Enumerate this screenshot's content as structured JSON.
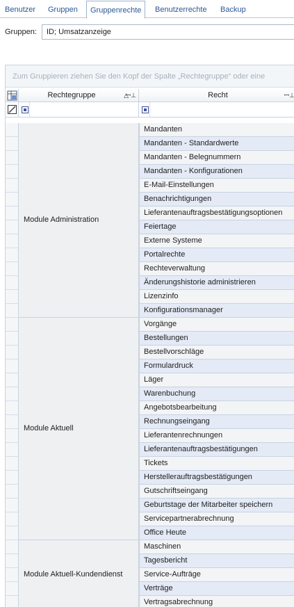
{
  "tabs": [
    {
      "label": "Benutzer",
      "active": false
    },
    {
      "label": "Gruppen",
      "active": false
    },
    {
      "label": "Gruppenrechte",
      "active": true
    },
    {
      "label": "Benutzerrechte",
      "active": false
    },
    {
      "label": "Backup",
      "active": false
    }
  ],
  "group_selector": {
    "label": "Gruppen:",
    "value": "ID; Umsatzanzeige"
  },
  "grid": {
    "group_hint": "Zum Gruppieren ziehen Sie den Kopf der Spalte „Rechtegruppe“ oder eine",
    "columns": [
      {
        "label": "Rechtegruppe",
        "sorted": "ascending",
        "pinned": true
      },
      {
        "label": "Recht",
        "pinned": true
      }
    ],
    "groups": [
      {
        "name": "Module Administration",
        "rights": [
          "Mandanten",
          "Mandanten - Standardwerte",
          "Mandanten - Belegnummern",
          "Mandanten - Konfigurationen",
          "E-Mail-Einstellungen",
          "Benachrichtigungen",
          "Lieferantenauftragsbestätigungsoptionen",
          "Feiertage",
          "Externe Systeme",
          "Portalrechte",
          "Rechteverwaltung",
          "Änderungshistorie administrieren",
          "Lizenzinfo",
          "Konfigurationsmanager"
        ]
      },
      {
        "name": "Module Aktuell",
        "rights": [
          "Vorgänge",
          "Bestellungen",
          "Bestellvorschläge",
          "Formulardruck",
          "Läger",
          "Warenbuchung",
          "Angebotsbearbeitung",
          "Rechnungseingang",
          "Lieferantenrechnungen",
          "Lieferantenauftragsbestätigungen",
          "Tickets",
          "Herstellerauftragsbestätigungen",
          "Gutschriftseingang",
          "Geburtstage der Mitarbeiter speichern",
          "Servicepartnerabrechnung",
          "Office Heute"
        ]
      },
      {
        "name": "Module Aktuell-Kundendienst",
        "rights": [
          "Maschinen",
          "Tagesbericht",
          "Service-Aufträge",
          "Verträge",
          "Vertragsabrechnung"
        ]
      }
    ]
  }
}
